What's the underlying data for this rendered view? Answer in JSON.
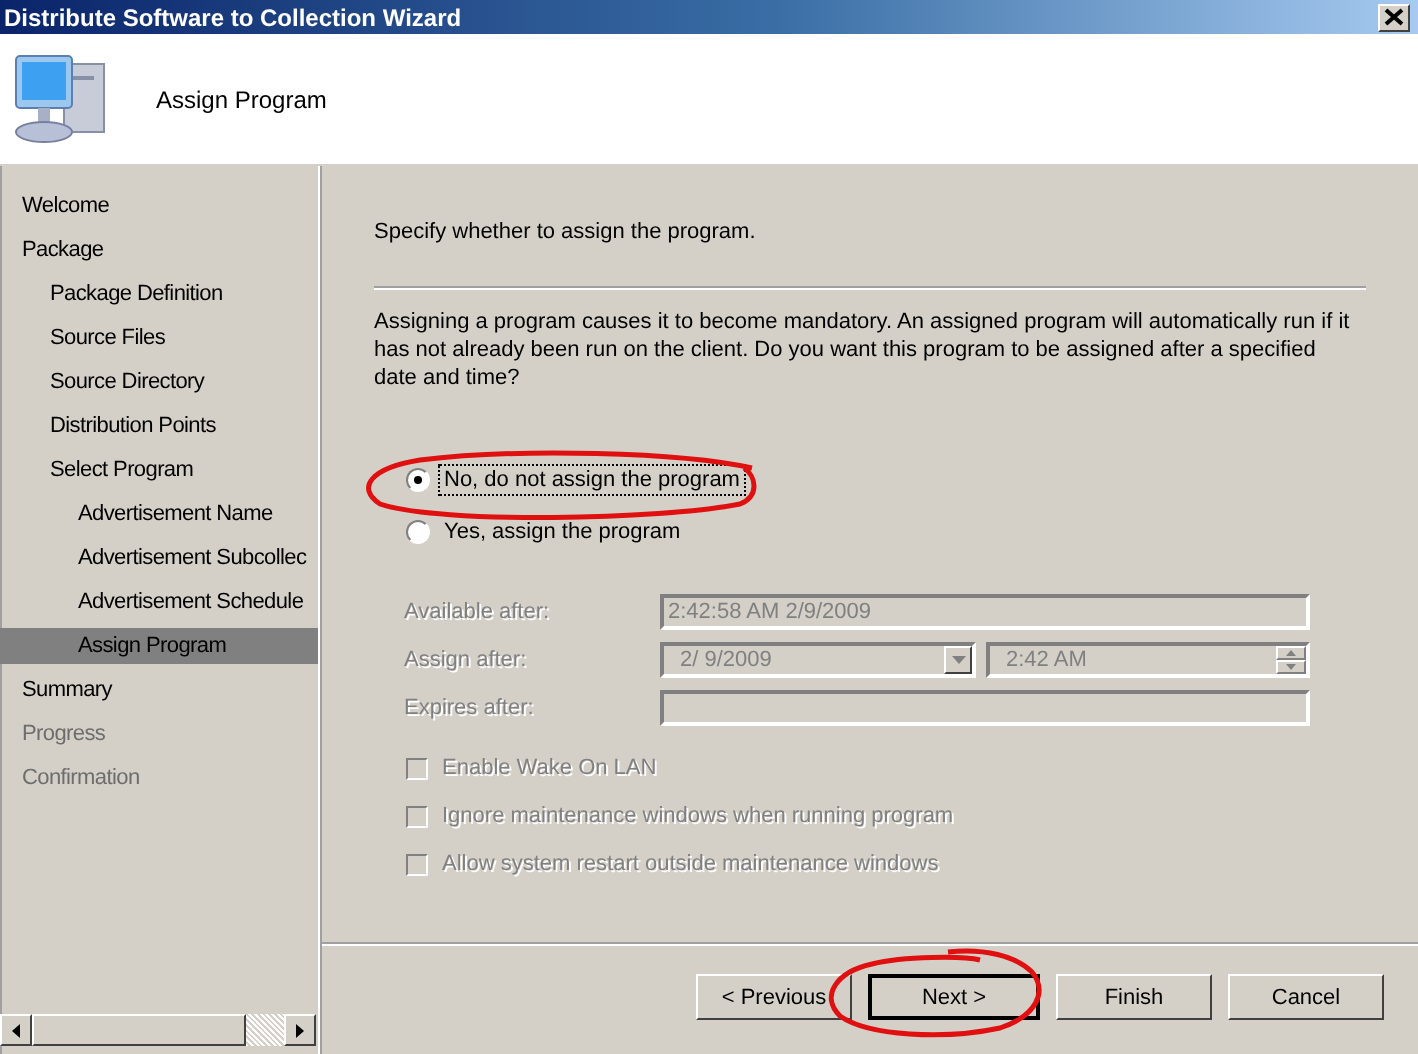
{
  "window": {
    "title": "Distribute Software to Collection Wizard"
  },
  "header": {
    "title": "Assign Program"
  },
  "steps": [
    {
      "label": "Welcome",
      "selected": false,
      "disabled": false
    },
    {
      "label": "Package",
      "selected": false,
      "disabled": false,
      "children": [
        {
          "label": "Package Definition",
          "selected": false,
          "disabled": false
        },
        {
          "label": "Source Files",
          "selected": false,
          "disabled": false
        },
        {
          "label": "Source Directory",
          "selected": false,
          "disabled": false
        },
        {
          "label": "Distribution Points",
          "selected": false,
          "disabled": false
        },
        {
          "label": "Select Program",
          "selected": false,
          "disabled": false,
          "children": [
            {
              "label": "Advertisement Name",
              "selected": false,
              "disabled": false
            },
            {
              "label": "Advertisement Subcollec",
              "selected": false,
              "disabled": false
            },
            {
              "label": "Advertisement Schedule",
              "selected": false,
              "disabled": false
            },
            {
              "label": "Assign Program",
              "selected": true,
              "disabled": false
            }
          ]
        }
      ]
    },
    {
      "label": "Summary",
      "selected": false,
      "disabled": false
    },
    {
      "label": "Progress",
      "selected": false,
      "disabled": true
    },
    {
      "label": "Confirmation",
      "selected": false,
      "disabled": true
    }
  ],
  "page": {
    "instruction": "Specify whether to assign the program.",
    "description": "Assigning a program causes it to become mandatory. An assigned program will automatically run if it has not already been run on the client. Do you want this program to be assigned after a specified date and time?",
    "options": [
      {
        "label": "No, do not assign the program",
        "selected": true
      },
      {
        "label": "Yes, assign the program",
        "selected": false
      }
    ],
    "fields": [
      {
        "kind": "text",
        "label": "Available after:",
        "value": "2:42:58 AM 2/9/2009",
        "disabled": true
      },
      {
        "kind": "datetime",
        "label": "Assign after:",
        "date": "2/  9/2009",
        "time": "2:42 AM",
        "disabled": true
      },
      {
        "kind": "text",
        "label": "Expires after:",
        "disabled": true
      }
    ],
    "checkboxes": [
      {
        "label": "Enable Wake On LAN",
        "checked": false,
        "disabled": true
      },
      {
        "label": "Ignore maintenance windows when running program",
        "checked": false,
        "disabled": true
      },
      {
        "label": "Allow system restart outside maintenance windows",
        "checked": false,
        "disabled": true
      }
    ]
  },
  "buttons": [
    {
      "label": "< Previous",
      "default": false
    },
    {
      "label": "Next >",
      "default": true
    },
    {
      "label": "Finish",
      "default": false
    },
    {
      "label": "Cancel",
      "default": false
    }
  ]
}
